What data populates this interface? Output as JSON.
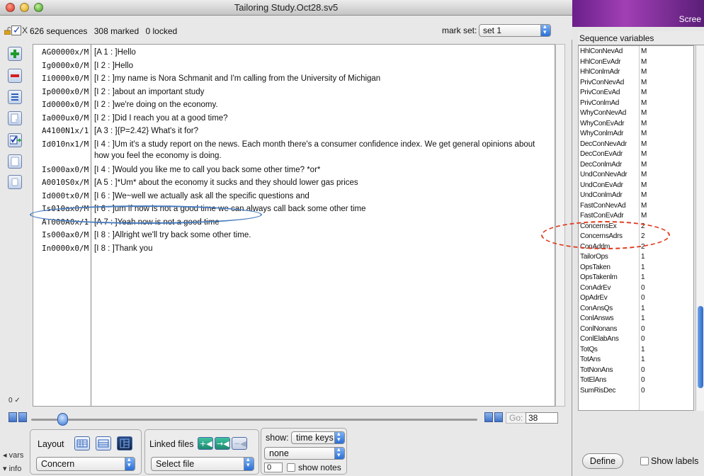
{
  "window": {
    "title": "Tailoring Study.Oct28.sv5"
  },
  "infobar": {
    "check_x_label": "X",
    "sequences": "626 sequences",
    "marked": "308 marked",
    "locked": "0 locked",
    "markset_label": "mark set:",
    "markset_value": "set 1"
  },
  "transcript": [
    {
      "code": "AG00000x/M",
      "text": "[A 1 : ]Hello"
    },
    {
      "code": "Ig0000x0/M",
      "text": "[I 2 : ]Hello"
    },
    {
      "code": "Ii0000x0/M",
      "text": "[I 2 : ]my name is Nora Schmanit and I'm calling from the University of Michigan"
    },
    {
      "code": "Ip0000x0/M",
      "text": "[I 2 : ]about an important study"
    },
    {
      "code": "Id0000x0/M",
      "text": "[I 2 : ]we're doing on the economy."
    },
    {
      "code": "Ia000ux0/M",
      "text": "[I 2 : ]Did I reach you at a good time?"
    },
    {
      "code": "A4100N1x/1",
      "text": "[A 3 : ]{P=2.42} What's it for?"
    },
    {
      "code": "Id010nx1/M",
      "text": "[I 4 : ]Um it's a study report on the news. Each month there's a consumer confidence index. We get general opinions about how you feel the economy is doing."
    },
    {
      "code": "Is000ax0/M",
      "text": "[I 4 : ]Would you like me to call you back some other time? *or*"
    },
    {
      "code": "A0010S0x/M",
      "text": "[A 5 : ]*Um* about the economy it sucks and they should lower gas prices"
    },
    {
      "code": "Id000tx0/M",
      "text": "[I 6 : ]We~well we actually ask all the specific questions and"
    },
    {
      "code": "Is010ax0/M",
      "text": "[I 6 : ]um if now is not a good time we can always call back some other time"
    },
    {
      "code": "AT000A0x/1",
      "text": "[A 7 : ]Yeah now is not a good time"
    },
    {
      "code": "Is000ax0/M",
      "text": "[I 8 : ]Allright we'll try back some other time."
    },
    {
      "code": "In0000x0/M",
      "text": "[I 8 : ]Thank you"
    }
  ],
  "side_counter": "0 ✓",
  "nav": {
    "go_label": "Go:",
    "go_value": "38",
    "slider_fraction": 0.07
  },
  "bottom": {
    "vars_label": "vars",
    "info_label": "info",
    "layout_label": "Layout",
    "layout_value": "Concern",
    "linked_label": "Linked files",
    "linked_value": "Select file",
    "show_label": "show:",
    "show_value": "time keys",
    "second_value": "none",
    "notes_input": "0",
    "show_notes": "show notes"
  },
  "right": {
    "title_fragment": "Scree",
    "header": "Sequence variables",
    "variables": [
      {
        "name": "HhlConNevAd",
        "value": "M"
      },
      {
        "name": "HhlConEvAdr",
        "value": "M"
      },
      {
        "name": "HhlConlmAdr",
        "value": "M"
      },
      {
        "name": "PrivConNevAd",
        "value": "M"
      },
      {
        "name": "PrivConEvAd",
        "value": "M"
      },
      {
        "name": "PrivConlmAd",
        "value": "M"
      },
      {
        "name": "WhyConNevAd",
        "value": "M"
      },
      {
        "name": "WhyConEvAdr",
        "value": "M"
      },
      {
        "name": "WhyConlmAdr",
        "value": "M"
      },
      {
        "name": "DecConNevAdr",
        "value": "M"
      },
      {
        "name": "DecConEvAdr",
        "value": "M"
      },
      {
        "name": "DecConlmAdr",
        "value": "M"
      },
      {
        "name": "UndConNevAdr",
        "value": "M"
      },
      {
        "name": "UndConEvAdr",
        "value": "M"
      },
      {
        "name": "UndConlmAdr",
        "value": "M"
      },
      {
        "name": "FastConNevAd",
        "value": "M"
      },
      {
        "name": "FastConEvAdr",
        "value": "M"
      },
      {
        "name": "ConcernsEx",
        "value": "2"
      },
      {
        "name": "ConcernsAdrs",
        "value": "2"
      },
      {
        "name": "ConAdrlm",
        "value": "2"
      },
      {
        "name": "TailorOps",
        "value": "1"
      },
      {
        "name": "OpsTaken",
        "value": "1"
      },
      {
        "name": "OpsTakenlm",
        "value": "1"
      },
      {
        "name": "ConAdrEv",
        "value": "0"
      },
      {
        "name": "OpAdrEv",
        "value": "0"
      },
      {
        "name": "ConAnsQs",
        "value": "1"
      },
      {
        "name": "ConlAnsws",
        "value": "1"
      },
      {
        "name": "ConlNonans",
        "value": "0"
      },
      {
        "name": "ConlElabAns",
        "value": "0"
      },
      {
        "name": "TotQs",
        "value": "1"
      },
      {
        "name": "TotAns",
        "value": "1"
      },
      {
        "name": "TotNonAns",
        "value": "0"
      },
      {
        "name": "TotElAns",
        "value": "0"
      },
      {
        "name": "SumRisDec",
        "value": "0"
      }
    ],
    "define_label": "Define",
    "show_labels": "Show labels"
  },
  "colors": {
    "accent": "#2a6fd6",
    "annotation_blue": "#4a7ec0",
    "annotation_red": "#e03a1e"
  }
}
